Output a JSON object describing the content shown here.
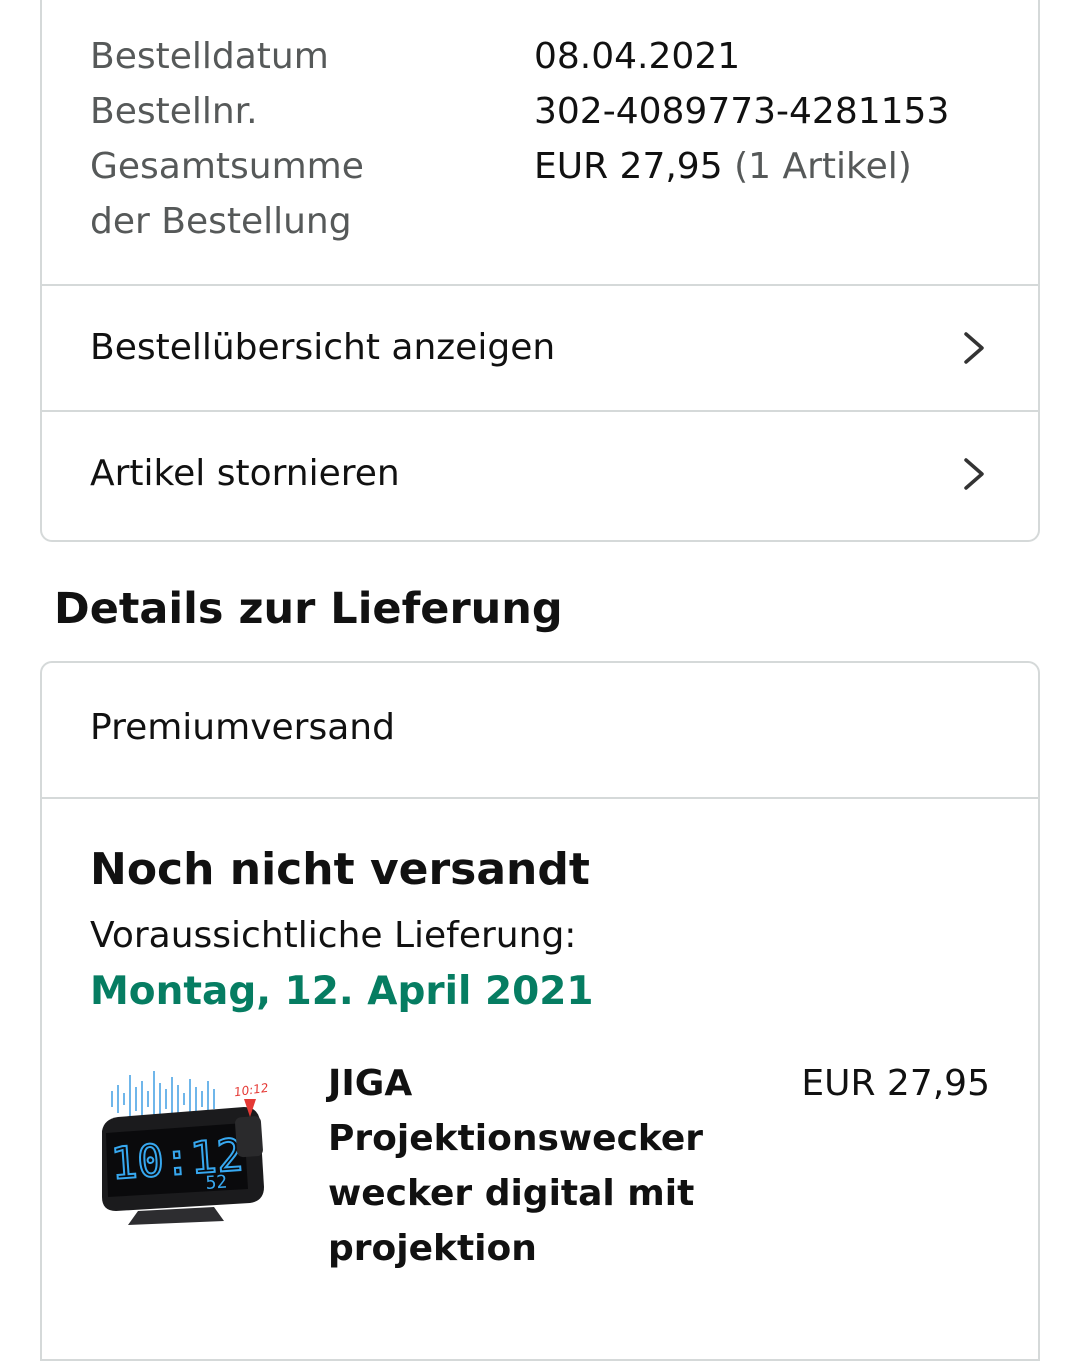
{
  "order_summary": {
    "rows": [
      {
        "label": "Bestelldatum",
        "value": "08.04.2021"
      },
      {
        "label": "Bestellnr.",
        "value": "302-4089773-4281153"
      },
      {
        "label": "Gesamtsumme der Bestellung",
        "value": "EUR 27,95",
        "value_note": "(1 Artikel)"
      }
    ],
    "links": [
      {
        "label": "Bestellübersicht anzeigen",
        "icon": "chevron-right-icon"
      },
      {
        "label": "Artikel stornieren",
        "icon": "chevron-right-icon"
      }
    ]
  },
  "delivery": {
    "section_title": "Details zur Lieferung",
    "shipping_method": "Premiumversand",
    "status": "Noch nicht versandt",
    "eta_label": "Voraussichtliche Lieferung:",
    "eta_date": "Montag, 12. April 2021",
    "item": {
      "title": "JIGA Projektionswecker wecker digital mit projektion",
      "price": "EUR 27,95",
      "image_icon": "projection-alarm-clock-image",
      "image_text": {
        "clock": "10:12",
        "projection": "10:12",
        "seconds": "52"
      }
    }
  },
  "colors": {
    "border": "#d5d9d9",
    "label_text": "#565959",
    "eta_green": "#067d62",
    "clock_digits": "#37a8f0",
    "projection_red": "#e53935"
  }
}
